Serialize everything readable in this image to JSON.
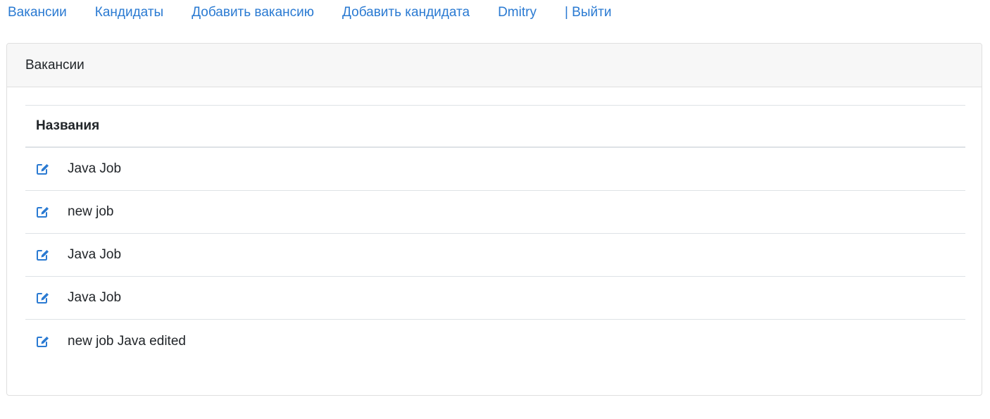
{
  "nav": {
    "items": [
      {
        "label": "Вакансии"
      },
      {
        "label": "Кандидаты"
      },
      {
        "label": "Добавить вакансию"
      },
      {
        "label": "Добавить кандидата"
      },
      {
        "label": "Dmitry"
      },
      {
        "label": "| Выйти"
      }
    ]
  },
  "card": {
    "header": "Вакансии",
    "table": {
      "column_header": "Названия",
      "rows": [
        {
          "title": "Java Job",
          "icon": "edit-icon"
        },
        {
          "title": "new job",
          "icon": "edit-icon"
        },
        {
          "title": "Java Job",
          "icon": "edit-icon"
        },
        {
          "title": "Java Job",
          "icon": "edit-icon"
        },
        {
          "title": "new job Java edited",
          "icon": "edit-icon"
        }
      ]
    }
  },
  "colors": {
    "link": "#2a7ad2",
    "header_bg": "#f7f7f7",
    "border": "#dee2e6"
  }
}
